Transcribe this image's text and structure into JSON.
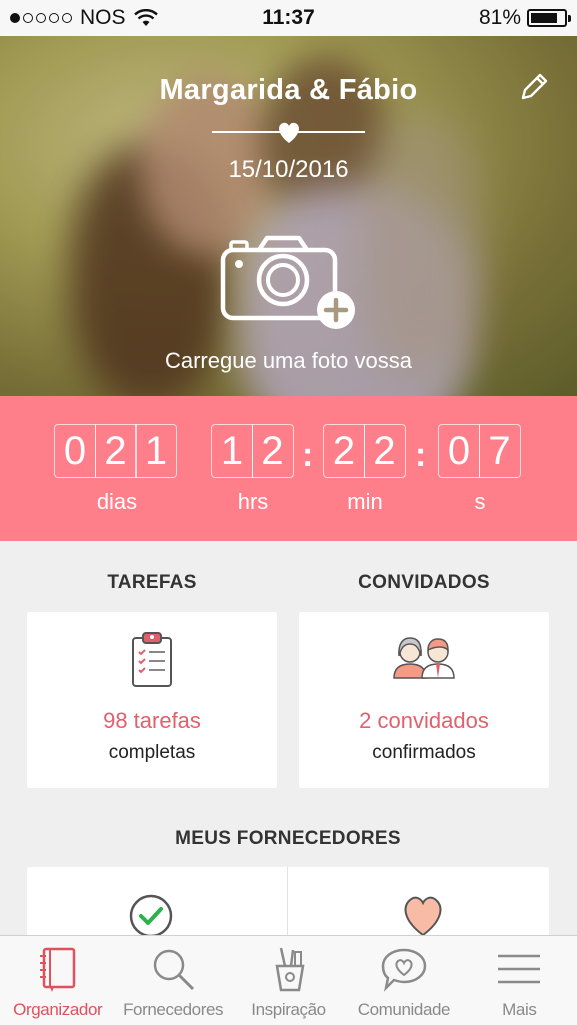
{
  "status_bar": {
    "carrier": "NOS",
    "time": "11:37",
    "battery": "81%",
    "battery_level": 0.81,
    "signal_bars": 1
  },
  "hero": {
    "couple_names": "Margarida & Fábio",
    "wedding_date": "15/10/2016",
    "upload_label": "Carregue uma foto vossa"
  },
  "countdown": {
    "days": [
      "0",
      "2",
      "1"
    ],
    "hours": [
      "1",
      "2"
    ],
    "minutes": [
      "2",
      "2"
    ],
    "seconds": [
      "0",
      "7"
    ],
    "days_label": "dias",
    "hours_label": "hrs",
    "minutes_label": "min",
    "seconds_label": "s"
  },
  "tasks": {
    "heading": "TAREFAS",
    "stat": "98 tarefas",
    "sub": "completas"
  },
  "guests": {
    "heading": "CONVIDADOS",
    "stat": "2 convidados",
    "sub": "confirmados"
  },
  "vendors": {
    "heading": "MEUS FORNECEDORES"
  },
  "tabs": [
    {
      "label": "Organizador",
      "icon": "notebook-icon",
      "active": true
    },
    {
      "label": "Fornecedores",
      "icon": "search-icon",
      "active": false
    },
    {
      "label": "Inspiração",
      "icon": "pencil-cup-icon",
      "active": false
    },
    {
      "label": "Comunidade",
      "icon": "chat-heart-icon",
      "active": false
    },
    {
      "label": "Mais",
      "icon": "menu-icon",
      "active": false
    }
  ],
  "colors": {
    "accent": "#fe7f8a",
    "accent_text": "#e0606c",
    "active_tab": "#e0515e"
  }
}
